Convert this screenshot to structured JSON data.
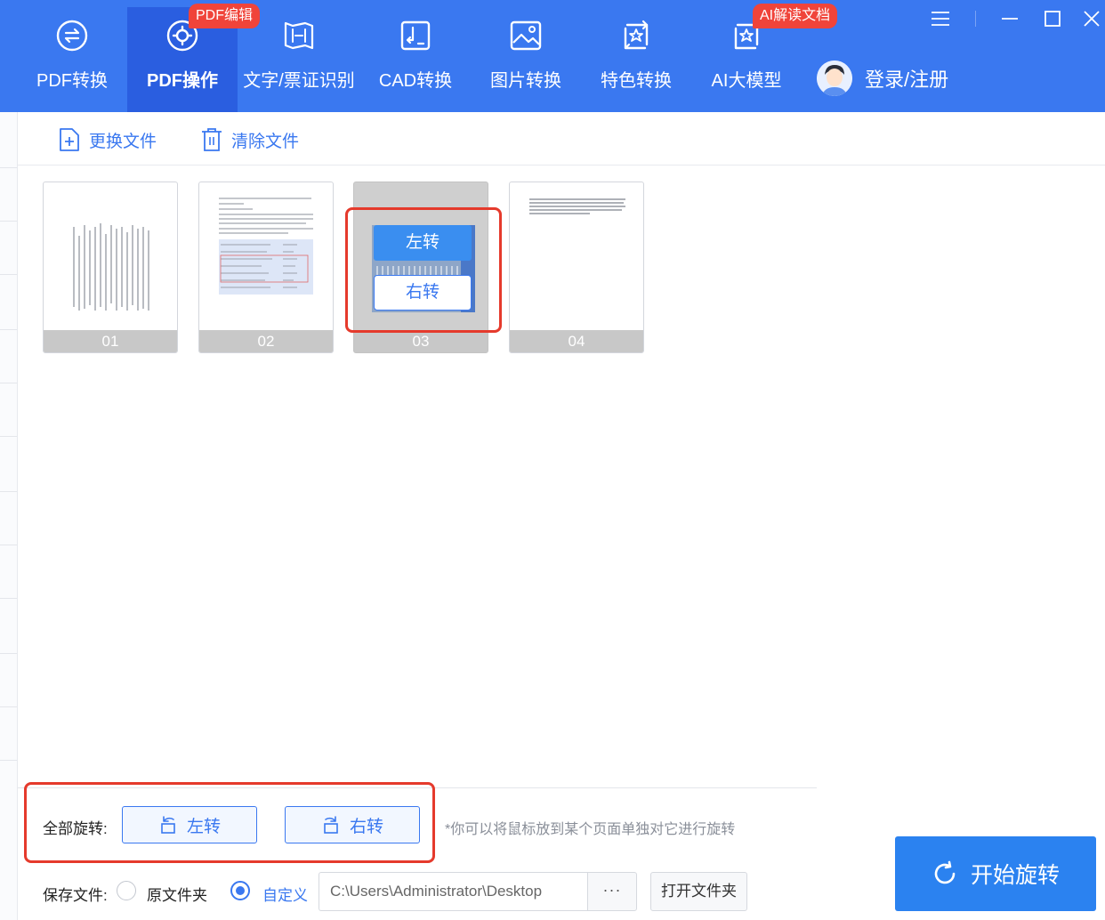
{
  "nav": {
    "items": [
      {
        "label": "PDF转换",
        "icon": "pdf-convert-icon"
      },
      {
        "label": "PDF操作",
        "icon": "pdf-operate-icon",
        "active": true,
        "badge": "PDF编辑"
      },
      {
        "label": "文字/票证识别",
        "icon": "ocr-scan-icon"
      },
      {
        "label": "CAD转换",
        "icon": "cad-convert-icon"
      },
      {
        "label": "图片转换",
        "icon": "image-convert-icon"
      },
      {
        "label": "特色转换",
        "icon": "feature-convert-icon"
      },
      {
        "label": "AI大模型",
        "icon": "ai-model-icon",
        "badge": "AI解读文档"
      }
    ],
    "login_label": "登录/注册",
    "window_controls": [
      "menu-icon",
      "minimize-icon",
      "maximize-icon",
      "close-icon"
    ]
  },
  "toolbar": {
    "replace_label": "更换文件",
    "clear_label": "清除文件"
  },
  "pages": [
    {
      "number": "01"
    },
    {
      "number": "02"
    },
    {
      "number": "03",
      "hovered": true
    },
    {
      "number": "04"
    }
  ],
  "page_hover": {
    "rotate_left": "左转",
    "rotate_right": "右转"
  },
  "rotate_all": {
    "label": "全部旋转:",
    "left_label": "左转",
    "right_label": "右转",
    "hint": "*你可以将鼠标放到某个页面单独对它进行旋转"
  },
  "save": {
    "label": "保存文件:",
    "option_original": "原文件夹",
    "option_custom": "自定义",
    "selected": "custom",
    "path": "C:\\Users\\Administrator\\Desktop",
    "browse_label": "···",
    "open_folder_label": "打开文件夹"
  },
  "start_label": "开始旋转",
  "colors": {
    "header": "#3a78f0",
    "header_active": "#2a5ee0",
    "accent": "#3a78f0",
    "badge": "#f0443a",
    "highlight_box": "#e53a2c",
    "start_button": "#2b82f0"
  }
}
